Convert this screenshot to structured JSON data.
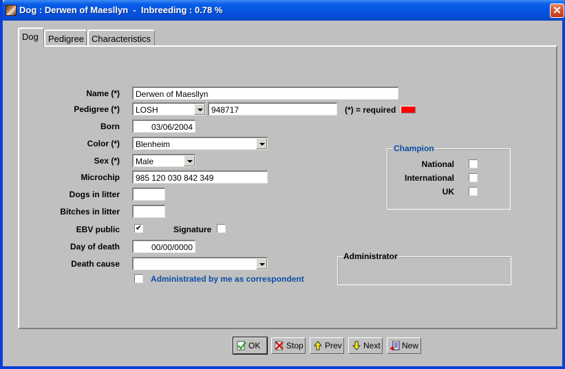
{
  "window": {
    "title": "Dog : Derwen of Maesllyn  -  Inbreeding : 0.78 %",
    "close_icon": "close-icon"
  },
  "tabs": [
    {
      "label": "Dog",
      "active": true
    },
    {
      "label": "Pedigree",
      "active": false
    },
    {
      "label": "Characteristics",
      "active": false
    }
  ],
  "form": {
    "name": {
      "label": "Name (*)",
      "value": "Derwen of Maesllyn"
    },
    "pedigree": {
      "label": "Pedigree (*)",
      "registry": "LOSH",
      "number": "948717"
    },
    "required_note": "(*) = required",
    "required_color": "#ff0000",
    "born": {
      "label": "Born",
      "value": "03/06/2004"
    },
    "color": {
      "label": "Color (*)",
      "value": "Blenheim"
    },
    "sex": {
      "label": "Sex (*)",
      "value": "Male"
    },
    "microchip": {
      "label": "Microchip",
      "value": "985 120 030 842 349"
    },
    "dogs_in_litter": {
      "label": "Dogs in litter",
      "value": ""
    },
    "bitches_in_litter": {
      "label": "Bitches in litter",
      "value": ""
    },
    "ebv_public": {
      "label": "EBV public",
      "checked": true,
      "mark": "✔"
    },
    "signature": {
      "label": "Signature",
      "checked": false
    },
    "day_of_death": {
      "label": "Day of death",
      "value": "00/00/0000"
    },
    "death_cause": {
      "label": "Death cause",
      "value": ""
    },
    "administrated": {
      "label": "Administrated by me as correspondent",
      "checked": false
    }
  },
  "champion": {
    "title": "Champion",
    "items": [
      {
        "label": "National",
        "checked": false
      },
      {
        "label": "International",
        "checked": false
      },
      {
        "label": "UK",
        "checked": false
      }
    ]
  },
  "administrator": {
    "title": "Administrator"
  },
  "buttons": [
    {
      "label": "OK",
      "icon": "ok-check-icon"
    },
    {
      "label": "Stop",
      "icon": "stop-x-icon"
    },
    {
      "label": "Prev",
      "icon": "arrow-up-icon"
    },
    {
      "label": "Next",
      "icon": "arrow-down-icon"
    },
    {
      "label": "New",
      "icon": "new-document-icon"
    }
  ]
}
